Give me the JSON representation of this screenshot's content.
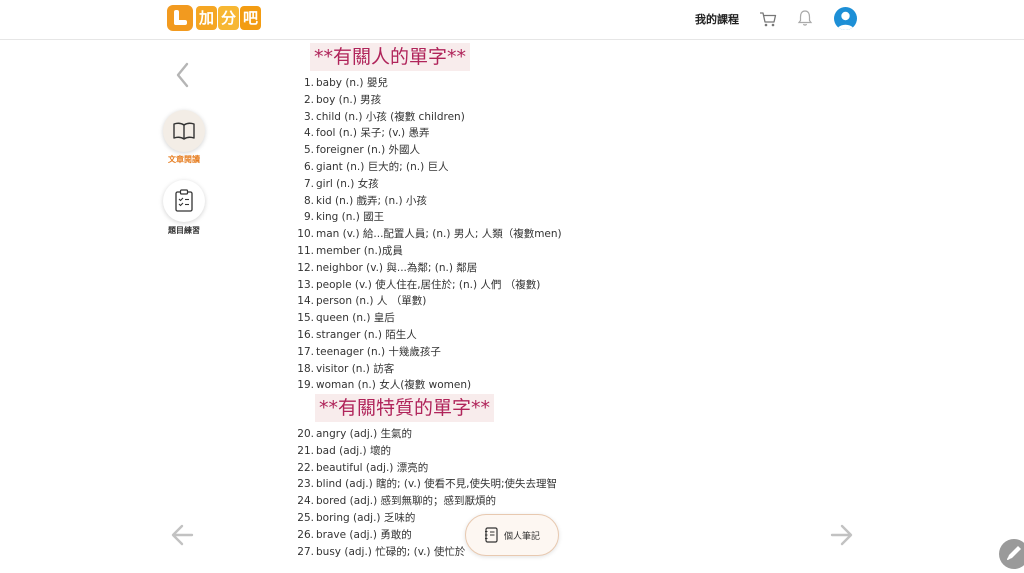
{
  "header": {
    "logo_text": [
      "加",
      "分",
      "吧"
    ],
    "nav_course": "我的課程",
    "icons": [
      "cart-icon",
      "bell-icon",
      "user-avatar"
    ]
  },
  "sidebar": {
    "items": [
      {
        "label": "文章閱讀",
        "icon": "book-icon",
        "active": true
      },
      {
        "label": "題目練習",
        "icon": "clipboard-icon",
        "active": false
      }
    ]
  },
  "sections": [
    {
      "title": "**有關人的單字**",
      "words": [
        {
          "num": "1.",
          "text": "baby (n.) 嬰兒"
        },
        {
          "num": "2.",
          "text": "boy (n.) 男孩"
        },
        {
          "num": "3.",
          "text": "child (n.) 小孩 (複數 children)"
        },
        {
          "num": "4.",
          "text": "fool (n.) 呆子; (v.) 愚弄"
        },
        {
          "num": "5.",
          "text": "foreigner (n.) 外國人"
        },
        {
          "num": "6.",
          "text": "giant (n.) 巨大的; (n.) 巨人"
        },
        {
          "num": "7.",
          "text": "girl (n.) 女孩"
        },
        {
          "num": "8.",
          "text": "kid (n.) 戲弄; (n.) 小孩"
        },
        {
          "num": "9.",
          "text": "king (n.) 國王"
        },
        {
          "num": "10.",
          "text": "man (v.) 給...配置人員; (n.) 男人; 人類（複數men)"
        },
        {
          "num": "11.",
          "text": "member (n.)成員"
        },
        {
          "num": "12.",
          "text": "neighbor (v.) 與...為鄰; (n.) 鄰居"
        },
        {
          "num": "13.",
          "text": "people (v.) 使人住在,居住於; (n.) 人們 （複數)"
        },
        {
          "num": "14.",
          "text": "person (n.) 人 （單數)"
        },
        {
          "num": "15.",
          "text": "queen (n.) 皇后"
        },
        {
          "num": "16.",
          "text": "stranger (n.) 陌生人"
        },
        {
          "num": "17.",
          "text": "teenager (n.) 十幾歲孩子"
        },
        {
          "num": "18.",
          "text": "visitor (n.) 訪客"
        },
        {
          "num": "19.",
          "text": "woman (n.) 女人(複數 women)"
        }
      ]
    },
    {
      "title": "**有關特質的單字**",
      "words": [
        {
          "num": "20.",
          "text": "angry (adj.) 生氣的"
        },
        {
          "num": "21.",
          "text": "bad (adj.) 壞的"
        },
        {
          "num": "22.",
          "text": "beautiful (adj.) 漂亮的"
        },
        {
          "num": "23.",
          "text": "blind (adj.) 瞎的; (v.) 使看不見,使失明;使失去理智"
        },
        {
          "num": "24.",
          "text": "bored (adj.) 感到無聊的；感到厭煩的"
        },
        {
          "num": "25.",
          "text": "boring (adj.) 乏味的"
        },
        {
          "num": "26.",
          "text": "brave (adj.) 勇敢的"
        },
        {
          "num": "27.",
          "text": "busy (adj.) 忙碌的; (v.) 使忙於"
        }
      ]
    }
  ],
  "footer": {
    "notes_label": "個人筆記"
  },
  "colors": {
    "accent": "#f29a1f",
    "section_title": "#b0245a",
    "section_bg": "#f8ecec",
    "active_label": "#e67e22"
  }
}
